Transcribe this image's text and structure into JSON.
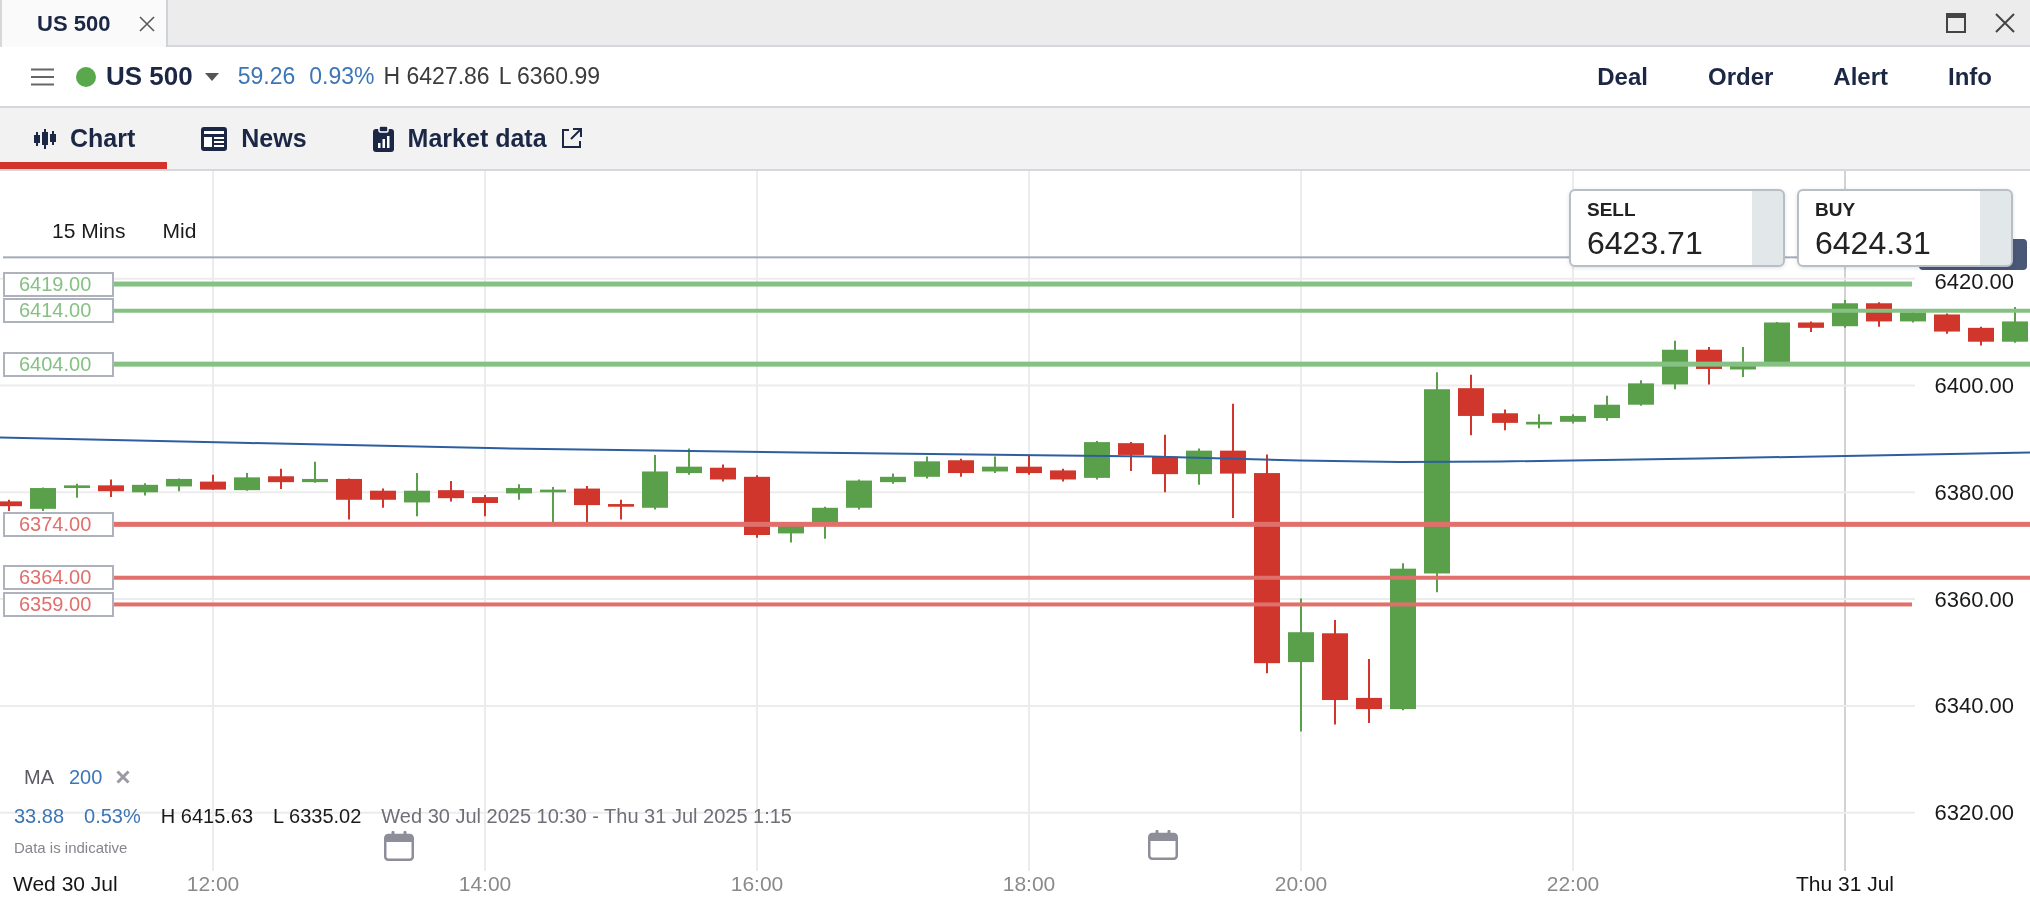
{
  "window": {
    "tabs": [
      {
        "title": "US 500",
        "selected": true
      }
    ]
  },
  "instrument": {
    "name": "US 500",
    "change": "59.26",
    "change_percent": "0.93%",
    "high": "H 6427.86",
    "low": "L 6360.99",
    "actions": [
      "Deal",
      "Order",
      "Alert",
      "Info"
    ]
  },
  "view_tabs": [
    {
      "label": "Chart",
      "kind": "chart",
      "selected": true,
      "external": false
    },
    {
      "label": "News",
      "kind": "news",
      "selected": false,
      "external": false
    },
    {
      "label": "Market data",
      "kind": "market-data",
      "selected": false,
      "external": true
    }
  ],
  "chart": {
    "interval": "15 Mins",
    "price_type": "Mid",
    "sell": {
      "label": "SELL",
      "price": "6423.71"
    },
    "buy": {
      "label": "BUY",
      "price": "6424.31"
    },
    "levels": [
      {
        "label": "6419.00",
        "color": "#86c184"
      },
      {
        "label": "6414.00",
        "color": "#86c184"
      },
      {
        "label": "6404.00",
        "color": "#86c184"
      },
      {
        "label": "6374.00",
        "color": "#e0706c"
      },
      {
        "label": "6364.00",
        "color": "#e0706c"
      },
      {
        "label": "6359.00",
        "color": "#e0706c"
      }
    ],
    "y_axis": [
      "6420.00",
      "6400.00",
      "6380.00",
      "6360.00",
      "6340.00",
      "6320.00"
    ],
    "x_axis": [
      {
        "label": "Wed 30 Jul",
        "kind": "date"
      },
      {
        "label": "12:00",
        "kind": "time"
      },
      {
        "label": "14:00",
        "kind": "time"
      },
      {
        "label": "16:00",
        "kind": "time"
      },
      {
        "label": "18:00",
        "kind": "time"
      },
      {
        "label": "20:00",
        "kind": "time"
      },
      {
        "label": "22:00",
        "kind": "time"
      },
      {
        "label": "Thu 31 Jul",
        "kind": "date"
      }
    ],
    "indicator": {
      "name": "MA",
      "period": "200"
    },
    "summary": {
      "change": "33.88",
      "change_percent": "0.53%",
      "high": "H 6415.63",
      "low": "L 6335.02",
      "range": "Wed 30 Jul 2025 10:30 - Thu 31 Jul 2025 1:15"
    },
    "note": "Data is indicative"
  }
}
